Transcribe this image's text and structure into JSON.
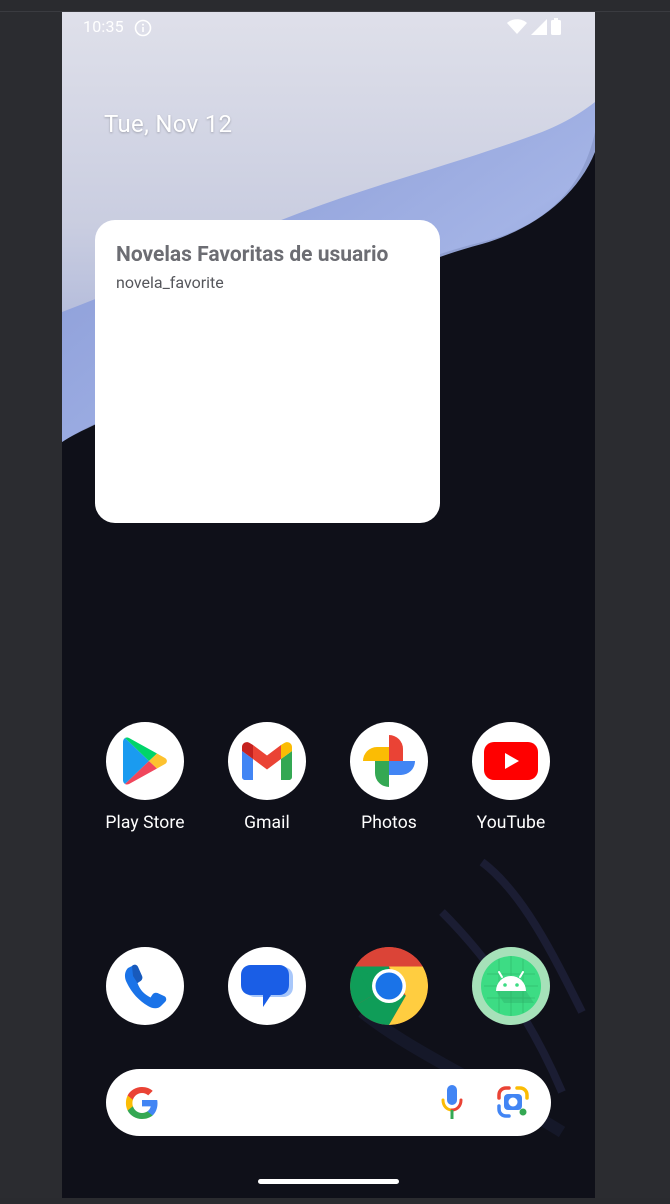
{
  "status_bar": {
    "time": "10:35",
    "icons": [
      "info-icon",
      "wifi-icon",
      "signal-icon",
      "battery-icon"
    ]
  },
  "home": {
    "date": "Tue, Nov 12"
  },
  "widget": {
    "title": "Novelas Favoritas de usuario",
    "subtitle": "novela_favorite"
  },
  "apps_row1": [
    {
      "label": "Play Store",
      "icon": "play-store-icon"
    },
    {
      "label": "Gmail",
      "icon": "gmail-icon"
    },
    {
      "label": "Photos",
      "icon": "photos-icon"
    },
    {
      "label": "YouTube",
      "icon": "youtube-icon"
    }
  ],
  "dock": [
    {
      "icon": "phone-icon"
    },
    {
      "icon": "messages-icon"
    },
    {
      "icon": "chrome-icon"
    },
    {
      "icon": "android-app-icon"
    }
  ],
  "search": {
    "icons": [
      "google-g-icon",
      "microphone-icon",
      "lens-icon"
    ]
  },
  "colors": {
    "wallpaper_dark": "#0f1019",
    "widget_bg": "#ffffff",
    "text_white": "#ffffff"
  }
}
